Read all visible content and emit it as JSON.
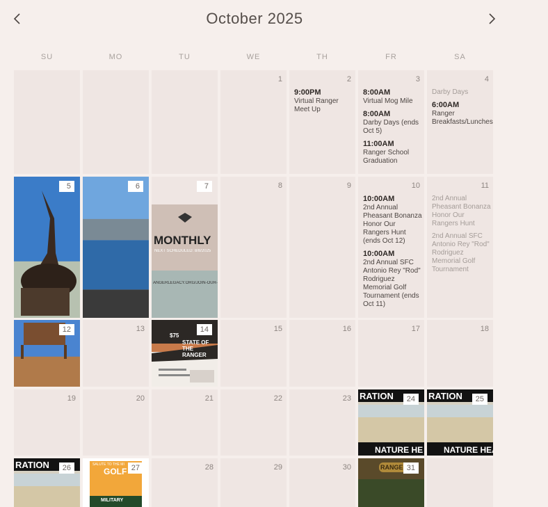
{
  "header": {
    "title": "October 2025",
    "prev": "previous-month",
    "next": "next-month"
  },
  "days_of_week": [
    "SU",
    "MO",
    "TU",
    "WE",
    "TH",
    "FR",
    "SA"
  ],
  "weeks": [
    [
      {
        "day": ""
      },
      {
        "day": ""
      },
      {
        "day": ""
      },
      {
        "day": "1"
      },
      {
        "day": "2",
        "events": [
          {
            "time": "9:00PM",
            "name": "Virtual Ranger Meet Up"
          }
        ]
      },
      {
        "day": "3",
        "events": [
          {
            "time": "8:00AM",
            "name": "Virtual Mog Mile"
          },
          {
            "time": "8:00AM",
            "name": "Darby Days (ends Oct 5)"
          },
          {
            "time": "11:00AM",
            "name": "Ranger School Graduation"
          }
        ]
      },
      {
        "day": "4",
        "events": [
          {
            "time": "",
            "name": "Darby Days",
            "muted": true
          },
          {
            "time": "6:00AM",
            "name": "Ranger Breakfasts/Lunches"
          }
        ]
      }
    ],
    [
      {
        "day": "5",
        "image": "statue"
      },
      {
        "day": "6",
        "image": "skyline"
      },
      {
        "day": "7",
        "image": "monthly",
        "overlay": {
          "headline": "MONTHLY",
          "sub": "NEXT SCHEDULED: 8/8/2025",
          "url": "ANGERLEGACY.ORG/JOIN-OUR-I"
        }
      },
      {
        "day": "8"
      },
      {
        "day": "9"
      },
      {
        "day": "10",
        "events": [
          {
            "time": "10:00AM",
            "name": "2nd Annual Pheasant Bonanza Honor Our Rangers Hunt (ends Oct 12)"
          },
          {
            "time": "10:00AM",
            "name": "2nd Annual SFC Antonio Rey \"Rod\" Rodriguez Memorial Golf Tournament (ends Oct 11)"
          }
        ]
      },
      {
        "day": "11",
        "events": [
          {
            "time": "",
            "name": "2nd Annual Pheasant Bonanza Honor Our Rangers Hunt",
            "muted": true
          },
          {
            "time": "",
            "name": "2nd Annual SFC Antonio Rey \"Rod\" Rodriguez Memorial Golf Tournament",
            "muted": true
          }
        ]
      }
    ],
    [
      {
        "day": "12",
        "image": "ranch"
      },
      {
        "day": "13"
      },
      {
        "day": "14",
        "image": "state",
        "overlay": {
          "headline": "STATE OF THE RANGER",
          "price": "$75"
        }
      },
      {
        "day": "15"
      },
      {
        "day": "16"
      },
      {
        "day": "17"
      },
      {
        "day": "18"
      }
    ],
    [
      {
        "day": "19"
      },
      {
        "day": "20"
      },
      {
        "day": "21"
      },
      {
        "day": "22"
      },
      {
        "day": "23"
      },
      {
        "day": "24",
        "image": "nature",
        "overlay": {
          "top": "RATION",
          "bottom": "NATURE HE"
        }
      },
      {
        "day": "25",
        "image": "nature",
        "overlay": {
          "top": "RATION",
          "bottom": "NATURE HEA"
        }
      }
    ],
    [
      {
        "day": "26",
        "image": "nature",
        "overlay": {
          "top": "RATION",
          "bottom": ""
        }
      },
      {
        "day": "27",
        "image": "golf",
        "overlay": {
          "top": "SALUTE TO THE MI",
          "headline": "GOLF",
          "bottom": "MILITARY"
        }
      },
      {
        "day": "28"
      },
      {
        "day": "29"
      },
      {
        "day": "30"
      },
      {
        "day": "31",
        "image": "ranger",
        "overlay": {
          "headline": "RANGER"
        }
      },
      {
        "day": ""
      }
    ]
  ],
  "colors": {
    "background": "#f6efec",
    "cell": "#efe6e3",
    "accent": "#2e2825"
  }
}
